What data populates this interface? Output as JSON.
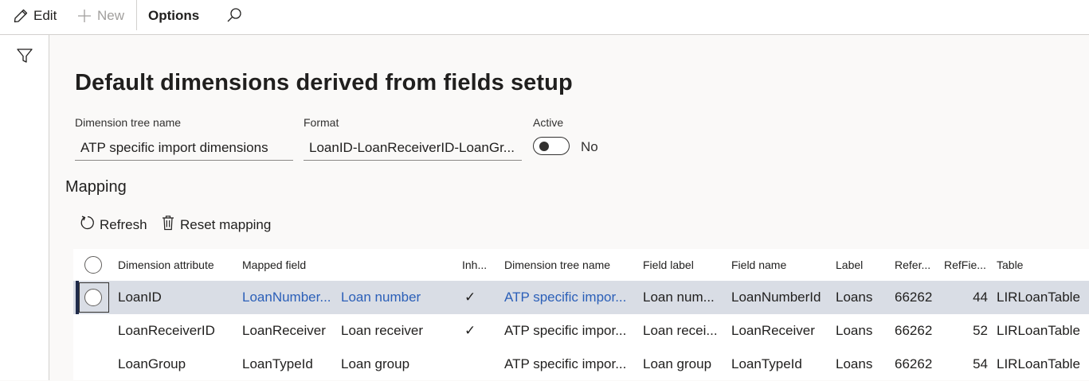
{
  "toolbar": {
    "edit_label": "Edit",
    "new_label": "New",
    "options_label": "Options"
  },
  "page": {
    "title": "Default dimensions derived from fields setup"
  },
  "fields": {
    "tree_name": {
      "label": "Dimension tree name",
      "value": "ATP specific import dimensions"
    },
    "format": {
      "label": "Format",
      "value": "LoanID-LoanReceiverID-LoanGr..."
    },
    "active": {
      "label": "Active",
      "value": "No",
      "on": false
    }
  },
  "mapping": {
    "title": "Mapping",
    "refresh_label": "Refresh",
    "reset_label": "Reset mapping"
  },
  "grid": {
    "columns": [
      "Dimension attribute",
      "Mapped field",
      "Inh...",
      "Dimension tree name",
      "Field label",
      "Field name",
      "Label",
      "Refer...",
      "RefFie...",
      "Table"
    ],
    "rows": [
      {
        "attribute": "LoanID",
        "mapped_field": "LoanNumber...",
        "mapped_label": "Loan number",
        "inherited": "✓",
        "tree": "ATP specific impor...",
        "field_label": "Loan num...",
        "field_name": "LoanNumberId",
        "label": "Loans",
        "ref": "66262",
        "reffield": "44",
        "table": "LIRLoanTable",
        "selected": true
      },
      {
        "attribute": "LoanReceiverID",
        "mapped_field": "LoanReceiver",
        "mapped_label": "Loan receiver",
        "inherited": "✓",
        "tree": "ATP specific impor...",
        "field_label": "Loan recei...",
        "field_name": "LoanReceiver",
        "label": "Loans",
        "ref": "66262",
        "reffield": "52",
        "table": "LIRLoanTable",
        "selected": false
      },
      {
        "attribute": "LoanGroup",
        "mapped_field": "LoanTypeId",
        "mapped_label": "Loan group",
        "inherited": "",
        "tree": "ATP specific impor...",
        "field_label": "Loan group",
        "field_name": "LoanTypeId",
        "label": "Loans",
        "ref": "66262",
        "reffield": "54",
        "table": "LIRLoanTable",
        "selected": false
      }
    ]
  },
  "colors": {
    "accent": "#2b5fb8",
    "selected_row": "#d9dde5",
    "selected_bar": "#1f2b4a"
  },
  "icons": [
    "pencil-icon",
    "plus-icon",
    "search-icon",
    "filter-icon",
    "refresh-icon",
    "trash-icon",
    "checkmark-icon",
    "toggle-switch"
  ]
}
